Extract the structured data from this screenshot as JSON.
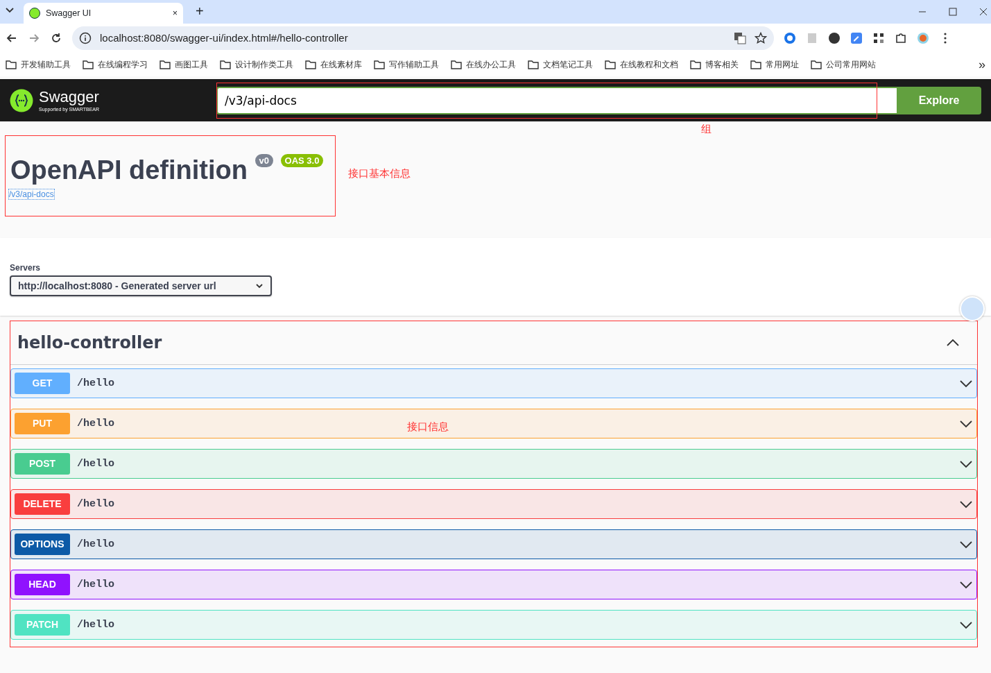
{
  "browser": {
    "tab_title": "Swagger UI",
    "tab_close": "×",
    "new_tab": "+",
    "address": "localhost:8080/swagger-ui/index.html#/hello-controller",
    "more": "»",
    "bookmarks": [
      "开发辅助工具",
      "在线编程学习",
      "画图工具",
      "设计制作类工具",
      "在线素材库",
      "写作辅助工具",
      "在线办公工具",
      "文档笔记工具",
      "在线教程和文档",
      "博客相关",
      "常用网址",
      "公司常用网站"
    ]
  },
  "topbar": {
    "logo_text": "Swagger",
    "logo_sub": "Supported by SMARTBEAR",
    "url": "/v3/api-docs",
    "explore": "Explore"
  },
  "info": {
    "title": "OpenAPI definition",
    "version": "v0",
    "oas": "OAS 3.0",
    "link": "/v3/api-docs"
  },
  "servers": {
    "label": "Servers",
    "value": "http://localhost:8080 - Generated server url"
  },
  "tag": {
    "name": "hello-controller",
    "expanded": true,
    "operations": [
      {
        "method": "GET",
        "path": "/hello",
        "color": "#61affe"
      },
      {
        "method": "PUT",
        "path": "/hello",
        "color": "#fca130"
      },
      {
        "method": "POST",
        "path": "/hello",
        "color": "#49cc90"
      },
      {
        "method": "DELETE",
        "path": "/hello",
        "color": "#f93e3e"
      },
      {
        "method": "OPTIONS",
        "path": "/hello",
        "color": "#0d5aa7"
      },
      {
        "method": "HEAD",
        "path": "/hello",
        "color": "#9012fe"
      },
      {
        "method": "PATCH",
        "path": "/hello",
        "color": "#50e3c2"
      }
    ]
  },
  "annotations": [
    {
      "text": "组"
    },
    {
      "text": "接口基本信息"
    },
    {
      "text": "接口信息"
    }
  ]
}
